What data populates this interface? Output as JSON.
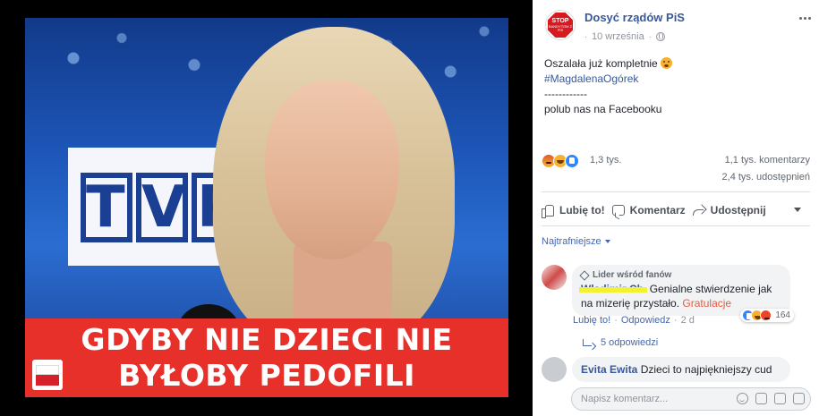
{
  "photo": {
    "banner_line_1": "GDYBY NIE DZIECI NIE",
    "banner_line_2": "BYŁOBY PEDOFILI",
    "board_letters": [
      "T",
      "V",
      "P"
    ]
  },
  "post": {
    "page_name": "Dosyć rządów PiS",
    "logo_text": "STOP",
    "logo_subtext": "BANDYTOM Z PIS",
    "date": "10 września",
    "privacy_icon": "globe-icon",
    "text_line_1": "Oszalała już kompletnie",
    "hashtag": "#MagdalenaOgórek",
    "separator": "------------",
    "text_line_3": "polub nas na Facebooku"
  },
  "stats": {
    "reactions": [
      "angry",
      "haha",
      "like"
    ],
    "reaction_count": "1,3 tys.",
    "comments": "1,1 tys. komentarzy",
    "shares": "2,4 tys. udostępnień"
  },
  "actions": {
    "like": "Lubię to!",
    "comment": "Komentarz",
    "share": "Udostępnij"
  },
  "comments_section": {
    "sort_label": "Najtrafniejsze",
    "comments": [
      {
        "badge": "Lider wśród fanów",
        "author": "Władimir Ch.",
        "text": "Genialne stwierdzenie jak na mizerię przystało.",
        "reply_highlight": "Gratulacje",
        "like_link": "Lubię to!",
        "reply_link": "Odpowiedz",
        "age": "2 d",
        "reaction_count": "164",
        "replies_label": "5 odpowiedzi"
      },
      {
        "author": "Evita Ewita",
        "text": "Dzieci to najpiękniejszy cud"
      }
    ]
  },
  "composer": {
    "placeholder": "Napisz komentarz..."
  },
  "colors": {
    "link": "#385898",
    "banner_red": "#e8302b",
    "accent": "#e9593a"
  }
}
